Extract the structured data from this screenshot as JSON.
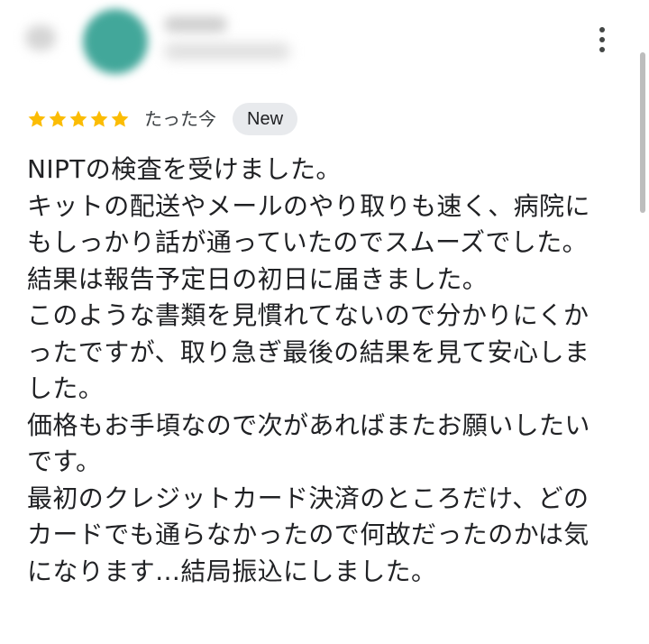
{
  "review": {
    "rating": 5,
    "max_rating": 5,
    "star_color": "#fbbc04",
    "time_ago": "たった今",
    "badge": "New",
    "lines": [
      "NIPTの検査を受けました。",
      "キットの配送やメールのやり取りも速く、病院に",
      "もしっかり話が通っていたのでスムーズでした。",
      "結果は報告予定日の初日に届きました。",
      "このような書類を見慣れてないので分かりにくか",
      "ったですが、取り急ぎ最後の結果を見て安心しま",
      "した。",
      "価格もお手頃なので次があればまたお願いしたい",
      "です。",
      "最初のクレジットカード決済のところだけ、どの",
      "カードでも通らなかったので何故だったのかは気",
      "になります…結局振込にしました。"
    ]
  },
  "icons": {
    "more": "more-vert-icon",
    "star": "star-icon"
  },
  "colors": {
    "avatar": "#42a79a",
    "badge_bg": "#e8eaed",
    "text": "#202124"
  }
}
